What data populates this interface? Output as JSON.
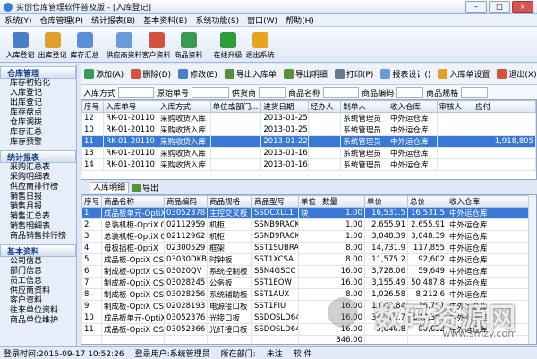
{
  "window": {
    "title": "实创仓库管理软件普及版 - [入库登记]",
    "min": "–",
    "max": "□",
    "close": "×"
  },
  "menu": [
    "系统(Y)",
    "仓库管理(P)",
    "统计报表(B)",
    "基本资料(B)",
    "系统功能(S)",
    "窗口(W)",
    "帮助(H)"
  ],
  "toolbar": [
    {
      "label": "入库登记",
      "icon": "inbound-icon",
      "color": "#4a7fc8"
    },
    {
      "label": "出库登记",
      "icon": "outbound-icon",
      "color": "#e0a12b"
    },
    {
      "label": "库存汇总",
      "icon": "stock-summary-icon",
      "color": "#5b8fd4"
    },
    {
      "label": "供应商资料",
      "icon": "supplier-icon",
      "color": "#6a9ad8"
    },
    {
      "label": "客户资料",
      "icon": "customer-icon",
      "color": "#d6523c"
    },
    {
      "label": "商品资料",
      "icon": "goods-icon",
      "color": "#3a9a55"
    },
    {
      "label": "在线升级",
      "icon": "upgrade-icon",
      "color": "#2f9b3a"
    },
    {
      "label": "退出系统",
      "icon": "exit-icon",
      "color": "#e7a421"
    }
  ],
  "sidebar": [
    {
      "title": "仓库管理",
      "items": [
        "库存初始化",
        "入库登记",
        "出库登记",
        "库存盘点",
        "仓库调拨",
        "库存汇总",
        "库存预警"
      ]
    },
    {
      "title": "统计报表",
      "items": [
        "采购汇总表",
        "采购明细表",
        "供应商排行榜",
        "销售日报",
        "销售月报",
        "销售汇总表",
        "销售明细表",
        "商品销售排行榜"
      ]
    },
    {
      "title": "基本资料",
      "items": [
        "公司信息",
        "部门信息",
        "员工信息",
        "供应商资料",
        "客户资料",
        "往来单位资料",
        "商品单位维护"
      ]
    }
  ],
  "subtoolbar": [
    {
      "label": "添加(A)",
      "color": "#3a9a55"
    },
    {
      "label": "删除(D)",
      "color": "#d6523c"
    },
    {
      "label": "修改(E)",
      "color": "#4a7fc8"
    },
    {
      "label": "导出入库单",
      "color": "#5a8f3a"
    },
    {
      "label": "导出明细",
      "color": "#5a8f3a"
    },
    {
      "label": "打印(P)",
      "color": "#6a7a8a"
    },
    {
      "label": "报表设计()",
      "color": "#6a9ad8"
    },
    {
      "label": "入库单设置",
      "color": "#e0a12b"
    },
    {
      "label": "退出(X)",
      "color": "#d6523c"
    }
  ],
  "filter": [
    "入库方式",
    "原始单号",
    "供货商",
    "商品名称",
    "商品编码",
    "商品规格"
  ],
  "orders": {
    "headers": [
      "序号",
      "入库单号",
      "入库方式",
      "单位或部门...",
      "进货日期",
      "经办人",
      "制单人",
      "收入仓库",
      "审核人",
      "应付"
    ],
    "rows": [
      [
        "12",
        "RK-01-20110",
        "采购收货入库",
        "",
        "2013-01-25",
        "",
        "系统管理员",
        "中外运仓库",
        "",
        ""
      ],
      [
        "10",
        "RK-01-20110",
        "采购收货入库",
        "",
        "2013-01-25",
        "",
        "系统管理员",
        "中外运仓库",
        "",
        ""
      ],
      [
        "11",
        "RK-01-20110",
        "采购收货入库",
        "",
        "2013-01-22",
        "",
        "系统管理员",
        "中外运仓库",
        "",
        "1,918,805"
      ],
      [
        "13",
        "RK-01-20110",
        "采购收货入库",
        "",
        "2013-01-16",
        "",
        "系统管理员",
        "中外运仓库",
        "",
        ""
      ],
      [
        "14",
        "RK-01-20110",
        "采购收货入库",
        "",
        "2013-01-16",
        "",
        "系统管理员",
        "中外运仓库",
        "",
        ""
      ]
    ],
    "selected": 2
  },
  "tabs": {
    "detail": "入库明细",
    "export": "导出"
  },
  "details": {
    "headers": [
      "序号",
      "商品名称",
      "商品编码",
      "商品规格",
      "商品型号",
      "单位",
      "数量",
      "单价",
      "总价",
      "收入仓库"
    ],
    "rows": [
      [
        "1",
        "成品板单元-OptiX",
        "03052378",
        "主控交叉板",
        "SSDCXLL1",
        "块",
        "1.00",
        "16,531.5",
        "16,531.5",
        "中外运仓库"
      ],
      [
        "2",
        "总装机柜-OptiX O",
        "02112959",
        "机柜",
        "SSNB9RACK",
        "",
        "1.00",
        "2,655.91",
        "2,655.91",
        "中外运仓库"
      ],
      [
        "3",
        "总装机柜-OptiX O",
        "02112962",
        "机柜",
        "SSNB9RACK",
        "",
        "1.00",
        "3,048.39",
        "3,048.39",
        "中外运仓库"
      ],
      [
        "4",
        "母板插框-OptiX",
        "02300529",
        "框架",
        "SST1SUBRAC",
        "",
        "8.00",
        "14,731.9",
        "117,855",
        "中外运仓库"
      ],
      [
        "5",
        "成品板-OptiX OSN",
        "03030DKB",
        "时钟板",
        "SST1XCSA",
        "",
        "8.00",
        "11,575.2",
        "92,602",
        "中外运仓库"
      ],
      [
        "6",
        "制成板-OptiX OSN",
        "03020QV",
        "系统控制板",
        "SSN4GSCC",
        "",
        "16.00",
        "3,728.06",
        "59,649",
        "中外运仓库"
      ],
      [
        "7",
        "制成板-OptiX OSN",
        "03028245",
        "公务板",
        "SST1EOW",
        "",
        "16.00",
        "3,155.49",
        "50,487.8",
        "中外运仓库"
      ],
      [
        "8",
        "制成板-OptiX OSN",
        "03028256",
        "系统辅助板",
        "SST1AUX",
        "",
        "8.00",
        "1,026.58",
        "8,212.6",
        "中外运仓库"
      ],
      [
        "9",
        "制成板-OptiX OSN",
        "02028193",
        "电源接口板",
        "SST1PIU",
        "",
        "16.00",
        "1,043.84",
        "16,701",
        "中外运仓库"
      ],
      [
        "10",
        "成品板单元-OptiX",
        "03052376",
        "光接口板",
        "SSDOSLD64",
        "",
        "16.00",
        "34,272.7",
        "548,363",
        "中外运仓库"
      ],
      [
        "11",
        "成品板-OptiX OSN",
        "03052366",
        "光纤接口板",
        "SSDOSLD64",
        "",
        "16.00",
        "5,040.8",
        "80,652",
        "中外运仓库"
      ]
    ],
    "total": "846.00",
    "selected": 0
  },
  "status": {
    "login_time": "登录时间:2016-09-17 10:52:26",
    "user": "登录用户:系统管理员",
    "location": "所在部门:",
    "audit": "未注",
    "extra": "软 件"
  },
  "watermark": {
    "text": "数码资源网",
    "url": "www.smzy.com"
  }
}
